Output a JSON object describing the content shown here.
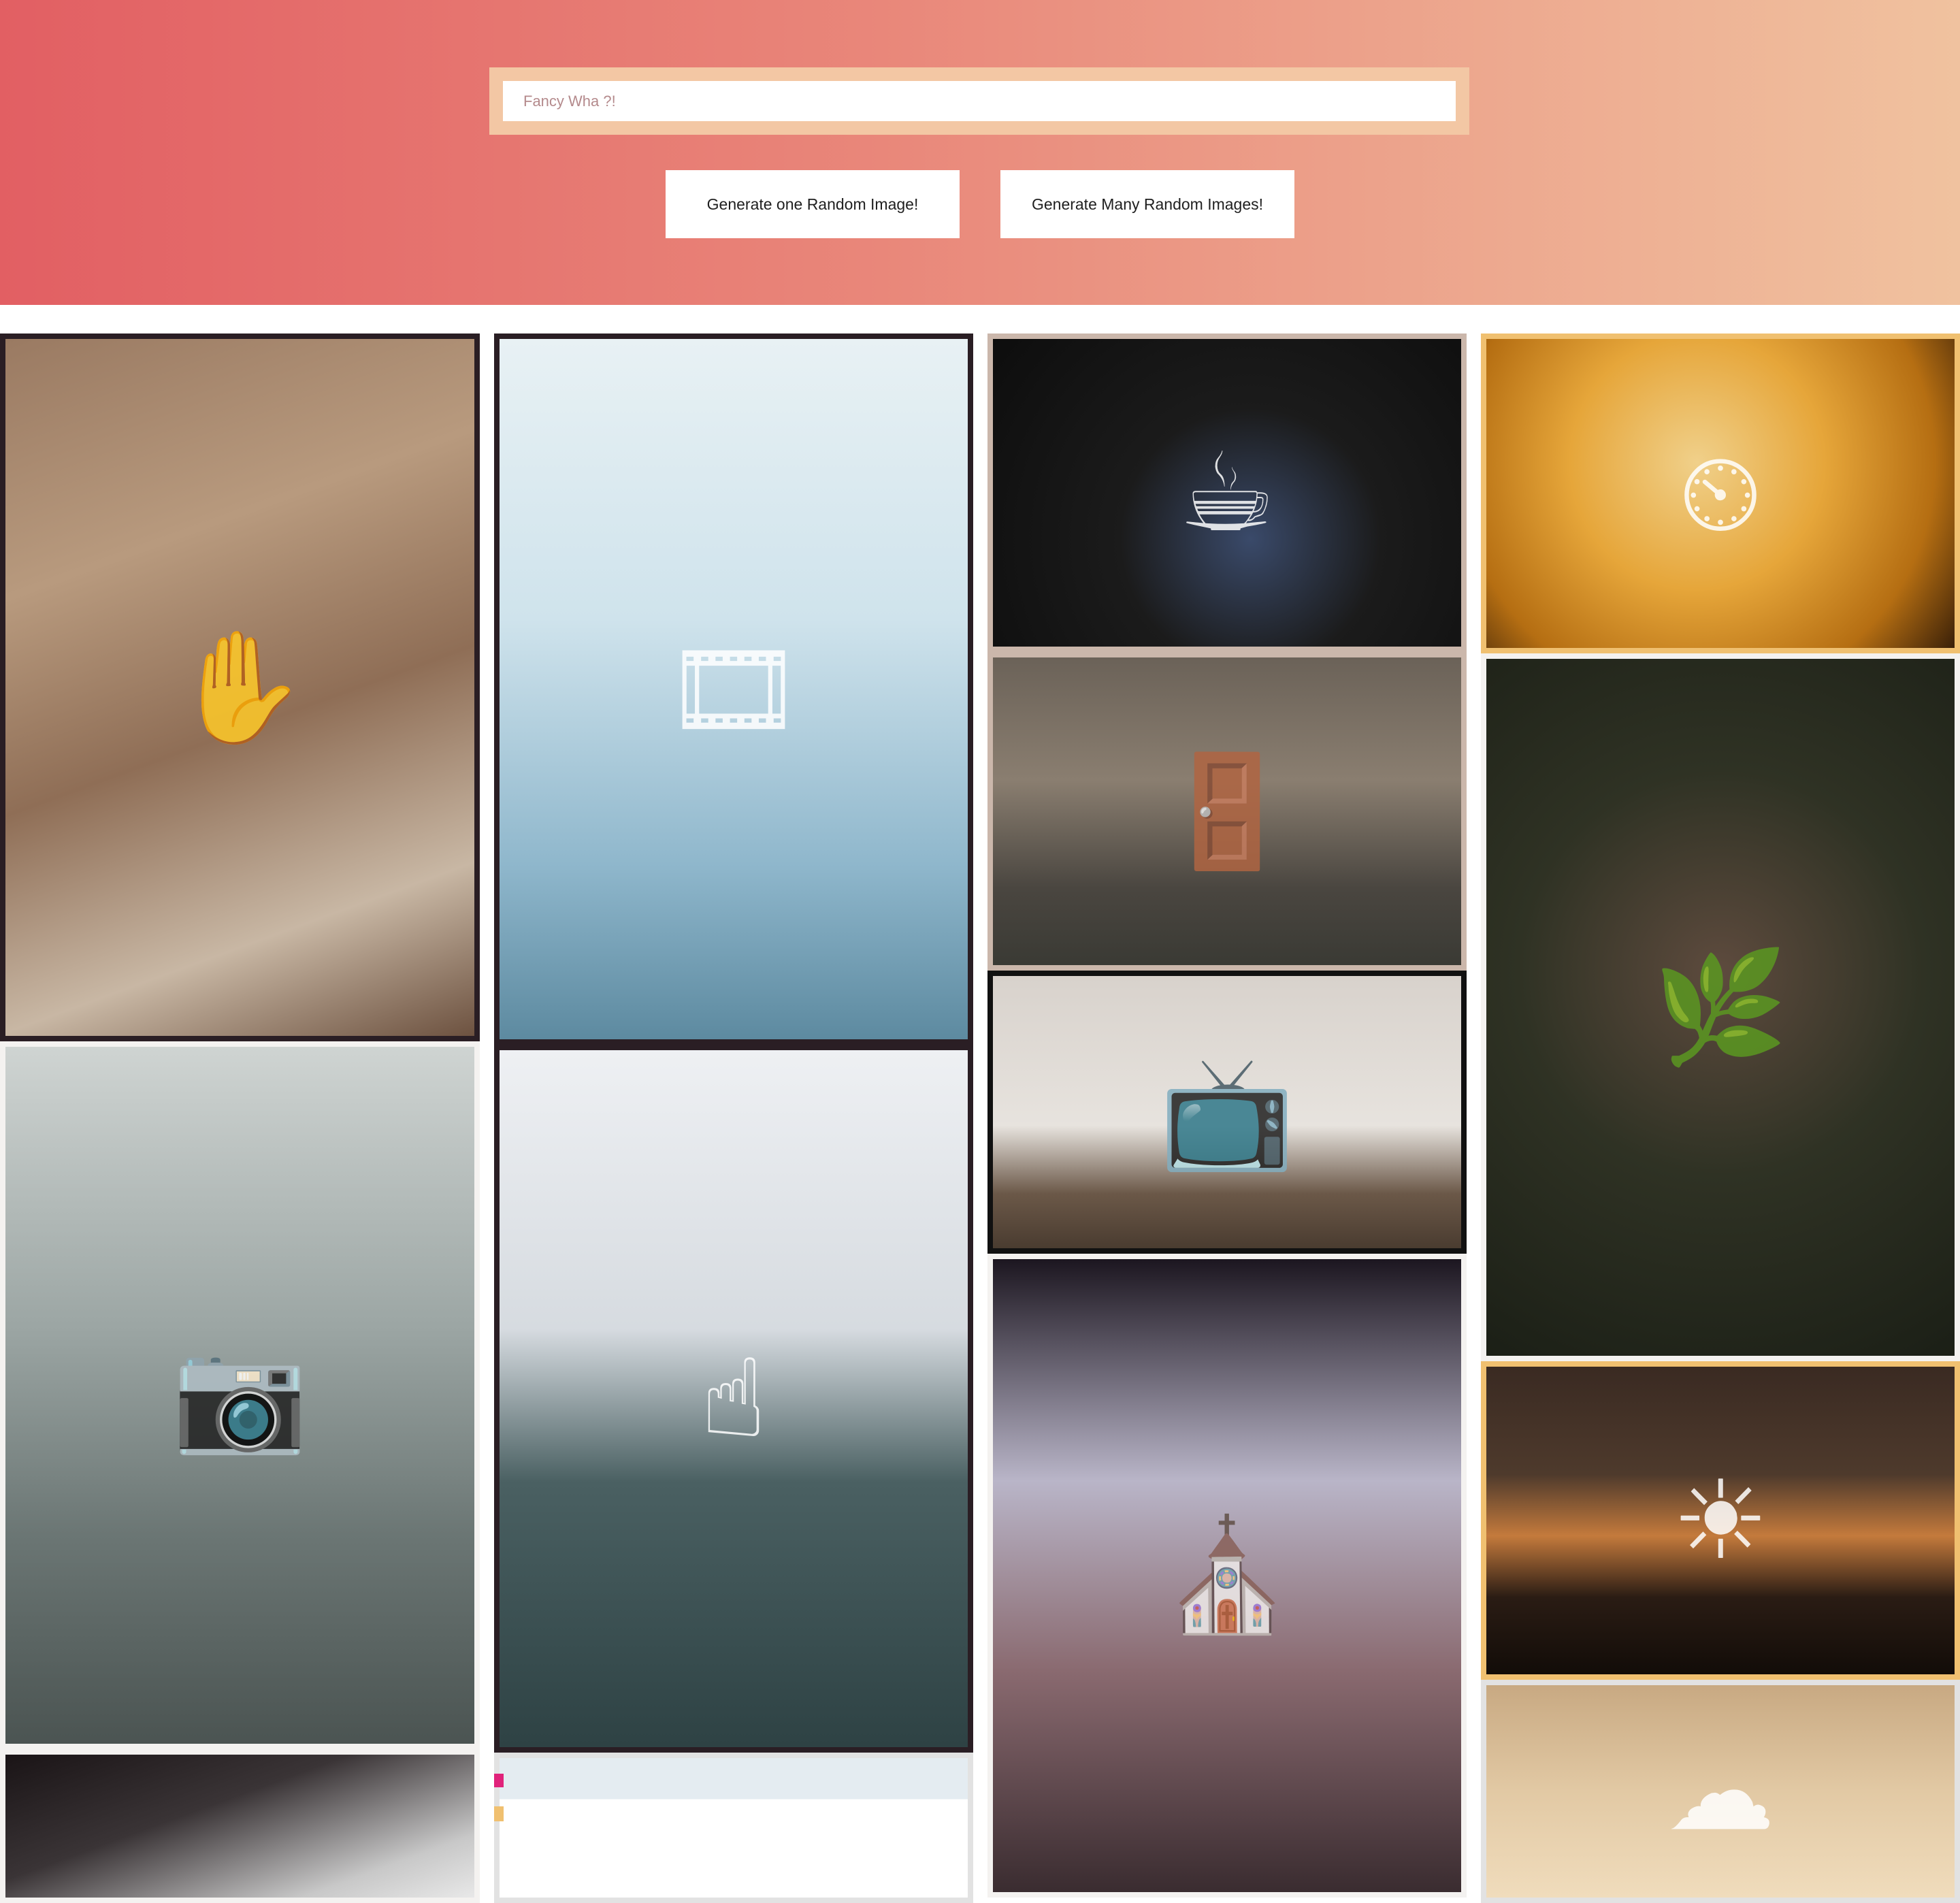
{
  "search": {
    "placeholder": "Fancy Wha ?!"
  },
  "actions": {
    "generate_one_label": "Generate one Random Image!",
    "generate_many_label": "Generate Many Random Images!"
  },
  "colors": {
    "hero_gradient_start": "#e25f63",
    "hero_gradient_end": "#f0c29f",
    "search_border": "#f3c7a4",
    "button_background": "#ffffff"
  },
  "gallery": {
    "images": [
      {
        "name": "gloves-newspaper-coffee",
        "icon": "glove-icon"
      },
      {
        "name": "foto-film-canister",
        "icon": "film-icon"
      },
      {
        "name": "pouring-coffee",
        "icon": "coffee-icon"
      },
      {
        "name": "barometer-on-wood",
        "icon": "gauge-icon"
      },
      {
        "name": "old-door-teddy-bear",
        "icon": "door-icon"
      },
      {
        "name": "person-on-garden-path",
        "icon": "leaf-icon"
      },
      {
        "name": "hanging-twin-lens-camera",
        "icon": "camera-icon"
      },
      {
        "name": "sydney-opera-house-hand",
        "icon": "hand-icon"
      },
      {
        "name": "old-tv-on-floor",
        "icon": "tv-icon"
      },
      {
        "name": "london-arch-big-ben",
        "icon": "arch-icon"
      },
      {
        "name": "mountain-sunset",
        "icon": "sun-icon"
      },
      {
        "name": "sky-clouds",
        "icon": "cloud-icon"
      },
      {
        "name": "photographer-with-camera",
        "icon": "camera-icon"
      },
      {
        "name": "loading-placeholder",
        "icon": "image-icon"
      }
    ]
  }
}
